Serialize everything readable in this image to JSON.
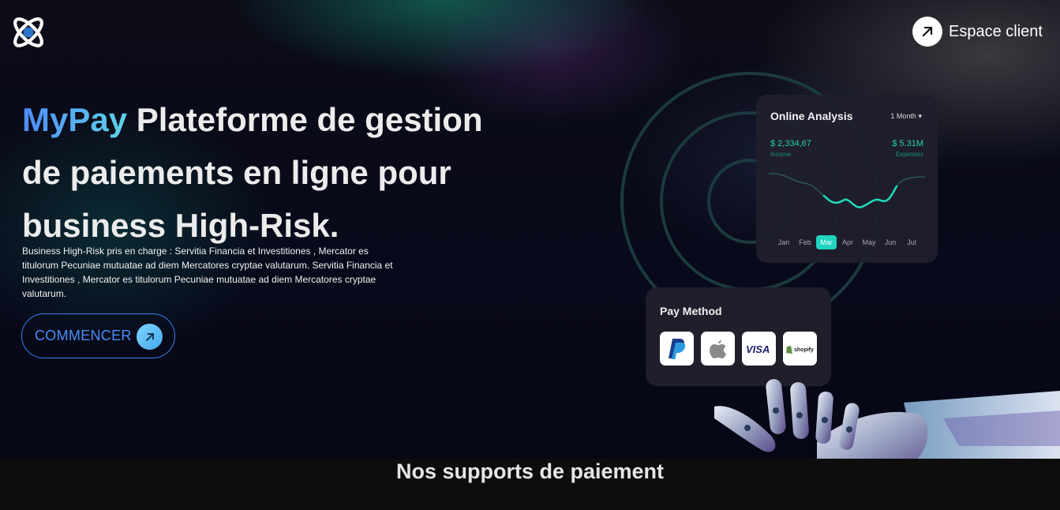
{
  "header": {
    "logo_icon": "atom-logo-icon",
    "client_button_label": "Espace client",
    "client_button_icon": "arrow-up-right-icon"
  },
  "hero": {
    "title_brand": "MyPay",
    "title_rest": " Plateforme de gestion de paiements en ligne pour business High-Risk.",
    "description": "Business High-Risk pris en charge : Servitia Financia et Investitiones , Mercator es titulorum Pecuniae mutuatae ad diem Mercatores cryptae valutarum. Servitia Financia et Investitiones , Mercator es titulorum Pecuniae mutuatae ad diem Mercatores cryptae valutarum.",
    "cta_label": "COMMENCER",
    "cta_icon": "arrow-up-right-icon"
  },
  "analysis_card": {
    "title": "Online Analysis",
    "period": "1 Month",
    "income_value": "$ 2,334,67",
    "income_label": "Income",
    "expenses_value": "$ 5.31M",
    "expenses_label": "Expenses",
    "months": [
      "Jan",
      "Feb",
      "Mar",
      "Apr",
      "May",
      "Jun",
      "Jul"
    ],
    "active_month": "Mar",
    "accent_color": "#20d3c0"
  },
  "pay_method_card": {
    "title": "Pay Method",
    "methods": [
      {
        "name": "PayPal",
        "icon": "paypal-icon"
      },
      {
        "name": "Apple",
        "icon": "apple-icon"
      },
      {
        "name": "VISA",
        "icon": "visa-icon"
      },
      {
        "name": "shopify",
        "icon": "shopify-icon"
      }
    ]
  },
  "supports_section": {
    "title": "Nos supports de paiement"
  },
  "colors": {
    "brand_blue": "#4b8cf5",
    "brand_cyan": "#5fd3e8",
    "background": "#07080f",
    "band": "#0d0d0d"
  }
}
